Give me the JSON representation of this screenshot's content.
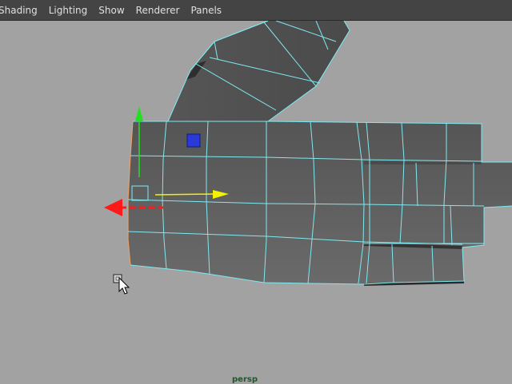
{
  "menubar": {
    "items": [
      {
        "label": "Shading"
      },
      {
        "label": "Lighting"
      },
      {
        "label": "Show"
      },
      {
        "label": "Renderer"
      },
      {
        "label": "Panels"
      }
    ]
  },
  "viewport": {
    "camera_label": "persp",
    "colors": {
      "background": "#a2a2a2",
      "mesh_face": "#5f5f5f",
      "wireframe": "#7fe9f1",
      "axis_x": "#ff1a1a",
      "axis_y": "#20e020",
      "axis_z": "#f2f200",
      "selected_vertex": "#2a3ad6"
    },
    "icons": {
      "mesh": "hand-mesh-icon",
      "manipulator": "move-manipulator-icon",
      "cursor": "arrow-cursor-icon"
    }
  }
}
